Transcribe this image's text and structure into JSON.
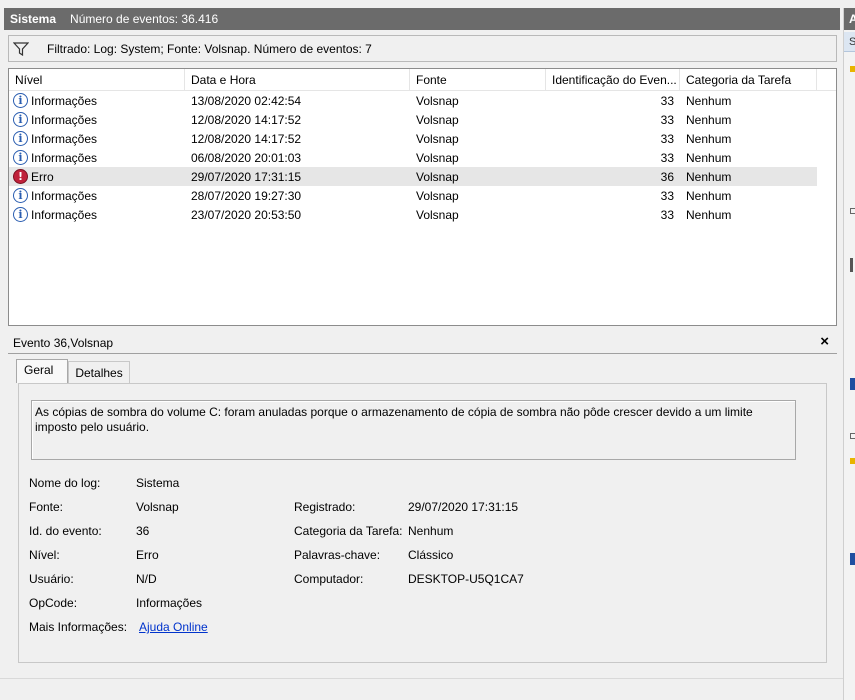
{
  "header": {
    "title": "Sistema",
    "event_count": "Número de eventos: 36.416"
  },
  "filter": {
    "icon": "funnel-icon",
    "text": "Filtrado: Log: System; Fonte: Volsnap. Número de eventos: 7"
  },
  "list": {
    "columns": [
      "Nível",
      "Data e Hora",
      "Fonte",
      "Identificação do Even...",
      "Categoria da Tarefa"
    ],
    "rows": [
      {
        "level": "Informações",
        "level_icon": "info-icon",
        "datetime": "13/08/2020 02:42:54",
        "source": "Volsnap",
        "id": "33",
        "category": "Nenhum"
      },
      {
        "level": "Informações",
        "level_icon": "info-icon",
        "datetime": "12/08/2020 14:17:52",
        "source": "Volsnap",
        "id": "33",
        "category": "Nenhum"
      },
      {
        "level": "Informações",
        "level_icon": "info-icon",
        "datetime": "12/08/2020 14:17:52",
        "source": "Volsnap",
        "id": "33",
        "category": "Nenhum"
      },
      {
        "level": "Informações",
        "level_icon": "info-icon",
        "datetime": "06/08/2020 20:01:03",
        "source": "Volsnap",
        "id": "33",
        "category": "Nenhum"
      },
      {
        "level": "Erro",
        "level_icon": "error-icon",
        "datetime": "29/07/2020 17:31:15",
        "source": "Volsnap",
        "id": "36",
        "category": "Nenhum"
      },
      {
        "level": "Informações",
        "level_icon": "info-icon",
        "datetime": "28/07/2020 19:27:30",
        "source": "Volsnap",
        "id": "33",
        "category": "Nenhum"
      },
      {
        "level": "Informações",
        "level_icon": "info-icon",
        "datetime": "23/07/2020 20:53:50",
        "source": "Volsnap",
        "id": "33",
        "category": "Nenhum"
      }
    ]
  },
  "detail": {
    "title": "Evento 36,Volsnap",
    "close": "×",
    "tabs": [
      "Geral",
      "Detalhes"
    ],
    "message": "As cópias de sombra do volume C: foram anuladas porque o armazenamento de cópia de sombra não pôde crescer devido a um limite imposto pelo usuário.",
    "labels": {
      "log_name": "Nome do log:",
      "source": "Fonte:",
      "event_id": "Id. do evento:",
      "level": "Nível:",
      "user": "Usuário:",
      "opcode": "OpCode:",
      "more_info": "Mais Informações:",
      "logged": "Registrado:",
      "task_category": "Categoria da Tarefa:",
      "keywords": "Palavras-chave:",
      "computer": "Computador:"
    },
    "values": {
      "log_name": "Sistema",
      "source": "Volsnap",
      "event_id": "36",
      "level": "Erro",
      "user": "N/D",
      "opcode": "Informações",
      "more_info": "Ajuda Online",
      "logged": "29/07/2020 17:31:15",
      "task_category": "Nenhum",
      "keywords": "Clássico",
      "computer": "DESKTOP-U5Q1CA7"
    }
  },
  "actions_pane": {
    "header": "A",
    "section": "S"
  },
  "colors": {
    "header_bg": "#6b6b6b",
    "selected_row": "#e6e6e6",
    "link": "#0033cc",
    "error": "#c0213a",
    "info": "#2a5db0"
  }
}
